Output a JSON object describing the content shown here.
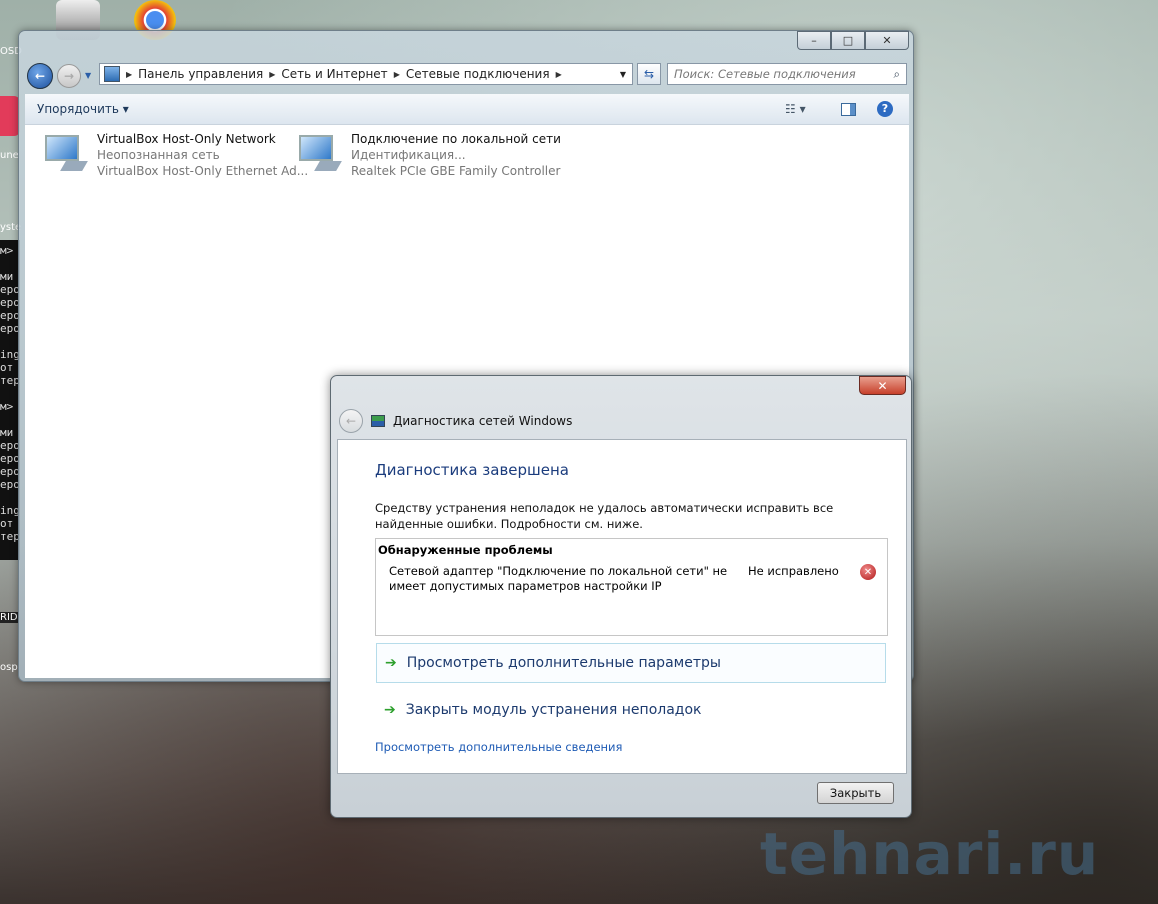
{
  "desktop": {
    "left_labels": [
      "OSD",
      "une",
      "yste",
      "RID",
      "osp"
    ],
    "console_lines": [
      "м>",
      "",
      "ми",
      "еро",
      "еро",
      "еро",
      "еро",
      "",
      "ing",
      "от",
      "тер",
      "",
      "м>",
      "",
      "ми",
      "еро",
      "еро",
      "еро",
      "еро",
      "",
      "ing",
      "от",
      "тер",
      "",
      "м>"
    ],
    "watermark": "tehnari.ru"
  },
  "explorer": {
    "window_buttons": {
      "minimize": "–",
      "maximize": "□",
      "close": "✕"
    },
    "breadcrumb": [
      "Панель управления",
      "Сеть и Интернет",
      "Сетевые подключения"
    ],
    "search_placeholder": "Поиск: Сетевые подключения",
    "toolbar": {
      "organize": "Упорядочить ▾"
    },
    "connections": [
      {
        "name": "VirtualBox Host-Only Network",
        "status": "Неопознанная сеть",
        "adapter": "VirtualBox Host-Only Ethernet Ad..."
      },
      {
        "name": "Подключение по локальной сети",
        "status": "Идентификация...",
        "adapter": "Realtek PCIe GBE Family Controller"
      }
    ]
  },
  "dialog": {
    "title": "Диагностика сетей Windows",
    "heading": "Диагностика завершена",
    "message": "Средству устранения неполадок не удалось автоматически исправить все найденные ошибки. Подробности см. ниже.",
    "problems": {
      "header": "Обнаруженные проблемы",
      "items": [
        {
          "description": "Сетевой адаптер \"Подключение по локальной сети\" не имеет допустимых параметров настройки IP",
          "status": "Не исправлено"
        }
      ]
    },
    "options": [
      "Просмотреть дополнительные параметры",
      "Закрыть модуль устранения неполадок"
    ],
    "details_link": "Просмотреть дополнительные сведения",
    "close_button": "Закрыть"
  }
}
